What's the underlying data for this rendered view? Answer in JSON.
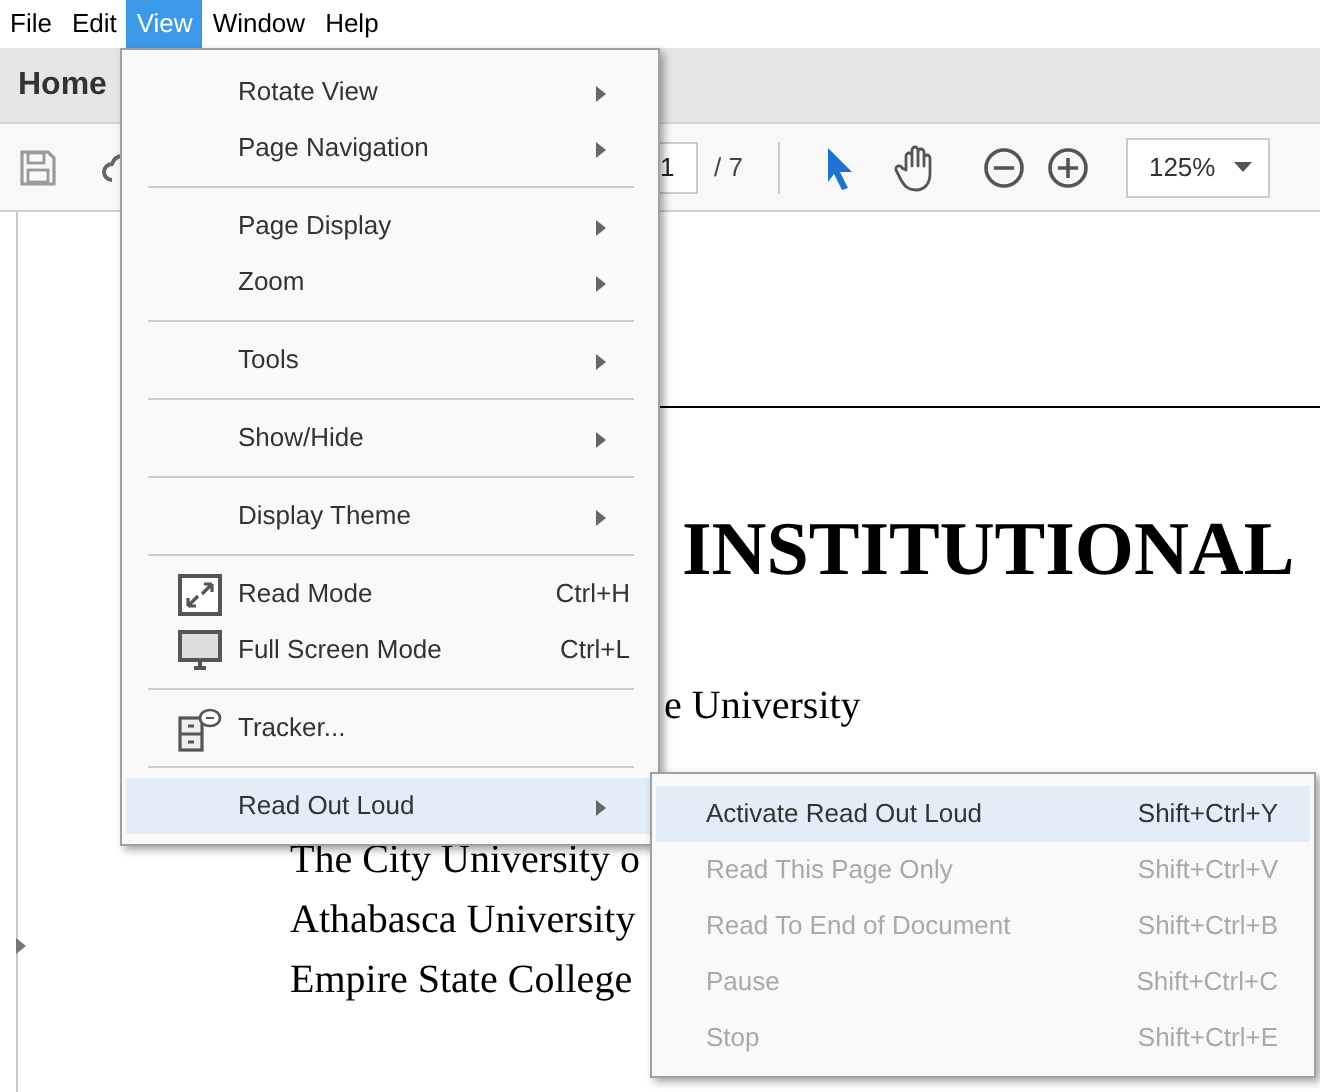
{
  "menubar": [
    {
      "label": "File",
      "selected": false
    },
    {
      "label": "Edit",
      "selected": false
    },
    {
      "label": "View",
      "selected": true
    },
    {
      "label": "Window",
      "selected": false
    },
    {
      "label": "Help",
      "selected": false
    }
  ],
  "tabs": [
    {
      "label": "Home"
    }
  ],
  "toolbar": {
    "page_field": "1",
    "page_total": "/ 7",
    "zoom": "125%"
  },
  "document": {
    "heading": "INSTITUTIONAL",
    "lines": [
      "e University",
      "The City University o",
      "Athabasca University",
      "Empire State College"
    ]
  },
  "view_menu": [
    {
      "kind": "item",
      "label": "Rotate View",
      "submenu": true,
      "selected": false
    },
    {
      "kind": "item",
      "label": "Page Navigation",
      "submenu": true,
      "selected": false
    },
    {
      "kind": "separator"
    },
    {
      "kind": "item",
      "label": "Page Display",
      "submenu": true,
      "selected": false
    },
    {
      "kind": "item",
      "label": "Zoom",
      "submenu": true,
      "selected": false
    },
    {
      "kind": "separator"
    },
    {
      "kind": "item",
      "label": "Tools",
      "submenu": true,
      "selected": false
    },
    {
      "kind": "separator"
    },
    {
      "kind": "item",
      "label": "Show/Hide",
      "submenu": true,
      "selected": false
    },
    {
      "kind": "separator"
    },
    {
      "kind": "item",
      "label": "Display Theme",
      "submenu": true,
      "selected": false
    },
    {
      "kind": "separator"
    },
    {
      "kind": "icon_item",
      "label": "Read Mode",
      "shortcut": "Ctrl+H",
      "selected": false
    },
    {
      "kind": "icon_item",
      "label": "Full Screen Mode",
      "shortcut": "Ctrl+L",
      "selected": false
    },
    {
      "kind": "separator"
    },
    {
      "kind": "icon_item",
      "label": "Tracker...",
      "selected": false
    },
    {
      "kind": "separator"
    },
    {
      "kind": "item",
      "label": "Read Out Loud",
      "submenu": true,
      "selected": true
    }
  ],
  "read_out_loud_menu": [
    {
      "label": "Activate Read Out Loud",
      "shortcut": "Shift+Ctrl+Y",
      "disabled": false,
      "selected": true
    },
    {
      "label": "Read This Page Only",
      "shortcut": "Shift+Ctrl+V",
      "disabled": true,
      "selected": false
    },
    {
      "label": "Read To End of Document",
      "shortcut": "Shift+Ctrl+B",
      "disabled": true,
      "selected": false
    },
    {
      "label": "Pause",
      "shortcut": "Shift+Ctrl+C",
      "disabled": true,
      "selected": false
    },
    {
      "label": "Stop",
      "shortcut": "Shift+Ctrl+E",
      "disabled": true,
      "selected": false
    }
  ]
}
